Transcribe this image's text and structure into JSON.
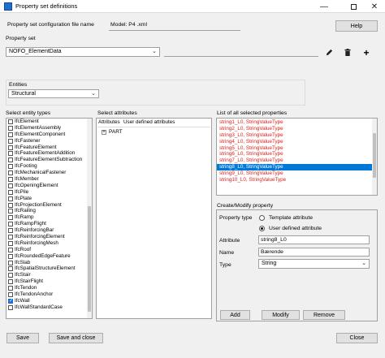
{
  "window": {
    "title": "Property set definitions"
  },
  "config": {
    "label": "Property set configuration file name",
    "value": "Model: P4 .xml",
    "help_label": "Help"
  },
  "property_set": {
    "label": "Property set",
    "selected": "NOFO_ElementData"
  },
  "entities": {
    "label": "Entities",
    "selected": "Structural"
  },
  "entity_types": {
    "label": "Select entity types",
    "items": [
      {
        "label": "IfcElement",
        "checked": false
      },
      {
        "label": "IfcElementAssembly",
        "checked": false
      },
      {
        "label": "IfcElementComponent",
        "checked": false
      },
      {
        "label": "IfcFastener",
        "checked": false
      },
      {
        "label": "IfcFeatureElement",
        "checked": false
      },
      {
        "label": "IfcFeatureElementAddition",
        "checked": false
      },
      {
        "label": "IfcFeatureElementSubtraction",
        "checked": false
      },
      {
        "label": "IfcFooting",
        "checked": false
      },
      {
        "label": "IfcMechanicalFastener",
        "checked": false
      },
      {
        "label": "IfcMember",
        "checked": false
      },
      {
        "label": "IfcOpeningElement",
        "checked": false
      },
      {
        "label": "IfcPile",
        "checked": false
      },
      {
        "label": "IfcPlate",
        "checked": false
      },
      {
        "label": "IfcProjectionElement",
        "checked": false
      },
      {
        "label": "IfcRailing",
        "checked": false
      },
      {
        "label": "IfcRamp",
        "checked": false
      },
      {
        "label": "IfcRampFlight",
        "checked": false
      },
      {
        "label": "IfcReinforcingBar",
        "checked": false
      },
      {
        "label": "IfcReinforcingElement",
        "checked": false
      },
      {
        "label": "IfcReinforcingMesh",
        "checked": false
      },
      {
        "label": "IfcRoof",
        "checked": false
      },
      {
        "label": "IfcRoundedEdgeFeature",
        "checked": false
      },
      {
        "label": "IfcSlab",
        "checked": false
      },
      {
        "label": "IfcSpatialStructureElement",
        "checked": false
      },
      {
        "label": "IfcStair",
        "checked": false
      },
      {
        "label": "IfcStairFlight",
        "checked": false
      },
      {
        "label": "IfcTendon",
        "checked": false
      },
      {
        "label": "IfcTendonAnchor",
        "checked": false
      },
      {
        "label": "IfcWall",
        "checked": true
      },
      {
        "label": "IfcWallStandardCase",
        "checked": false
      }
    ]
  },
  "attributes": {
    "label": "Select attributes",
    "tab_attributes": "Attributes",
    "tab_user_defined": "User defined attributes",
    "tree_root": "PART",
    "tree_expander": "+"
  },
  "selected_properties": {
    "label": "List of all selected properties",
    "items": [
      "string1_L0, StringValueType",
      "string2_L0, StringValueType",
      "string3_L0, StringValueType",
      "string4_L0, StringValueType",
      "string5_L0, StringValueType",
      "string6_L0, StringValueType",
      "string7_L0, StringValueType",
      "string8_L0, StringValueType",
      "string9_L0, StringValueType",
      "string10_L0, StringValueType"
    ],
    "selected_index": 7
  },
  "create_modify": {
    "label": "Create/Modify property",
    "property_type_label": "Property type",
    "option_template": "Template attribute",
    "option_user_defined": "User defined attribute",
    "selected_option": "user_defined",
    "attribute_label": "Attribute",
    "attribute_value": "string8_L0",
    "name_label": "Name",
    "name_value": "Bærende",
    "type_label": "Type",
    "type_value": "String",
    "add_label": "Add",
    "modify_label": "Modify",
    "remove_label": "Remove"
  },
  "footer": {
    "save_label": "Save",
    "save_close_label": "Save and close",
    "close_label": "Close"
  }
}
